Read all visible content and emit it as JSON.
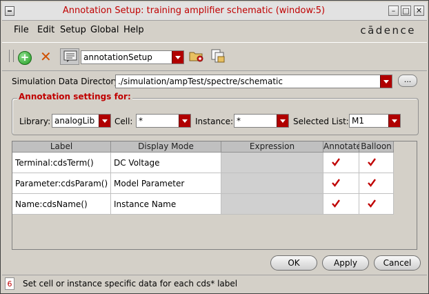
{
  "window": {
    "title": "Annotation Setup: training amplifier schematic (window:5)",
    "controls": {
      "minimize": "–",
      "maximize": "□",
      "close": "✕"
    }
  },
  "menubar": {
    "items": [
      "File",
      "Edit",
      "Setup",
      "Global",
      "Help"
    ],
    "logo": "cādence"
  },
  "toolbar": {
    "preset_value": "annotationSetup"
  },
  "simdir": {
    "label": "Simulation Data Directory:",
    "value": "./simulation/ampTest/spectre/schematic",
    "browse_label": "..."
  },
  "annotation": {
    "group_title": "Annotation settings for:",
    "library_label": "Library:",
    "library_value": "analogLib",
    "cell_label": "Cell:",
    "cell_value": "*",
    "instance_label": "Instance:",
    "instance_value": "*",
    "selected_list_label": "Selected List:",
    "selected_list_value": "M1"
  },
  "table": {
    "columns": [
      "Label",
      "Display Mode",
      "Expression",
      "Annotate",
      "Balloon"
    ],
    "rows": [
      {
        "label": "Terminal:cdsTerm()",
        "display_mode": "DC Voltage",
        "expression": "",
        "annotate": true,
        "balloon": true
      },
      {
        "label": "Parameter:cdsParam()",
        "display_mode": "Model Parameter",
        "expression": "",
        "annotate": true,
        "balloon": true
      },
      {
        "label": "Name:cdsName()",
        "display_mode": "Instance Name",
        "expression": "",
        "annotate": true,
        "balloon": true
      }
    ]
  },
  "buttons": {
    "ok": "OK",
    "apply": "Apply",
    "cancel": "Cancel"
  },
  "status": {
    "number": "6",
    "message": "Set cell or instance specific data for each cds* label"
  },
  "colors": {
    "accent": "#c00000",
    "check": "#c00000"
  }
}
